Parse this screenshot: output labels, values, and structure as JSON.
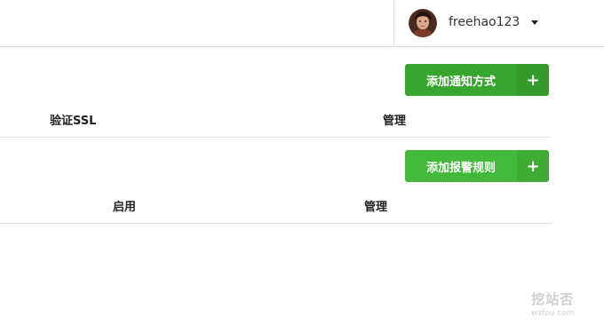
{
  "header": {
    "username": "freehao123",
    "avatar_icon": "user-avatar-icon",
    "dropdown_icon": "caret-down-icon"
  },
  "notify_section": {
    "add_button_label": "添加通知方式",
    "add_button_icon": "+",
    "columns": [
      "验证SSL",
      "管理"
    ]
  },
  "alert_section": {
    "add_button_label": "添加报警规则",
    "add_button_icon": "+",
    "columns": [
      "启用",
      "管理"
    ]
  },
  "watermark": {
    "title": "挖站否",
    "url": "wzfou.com"
  },
  "colors": {
    "button_green": "#38a62e",
    "button_green_light": "#43b83a"
  }
}
